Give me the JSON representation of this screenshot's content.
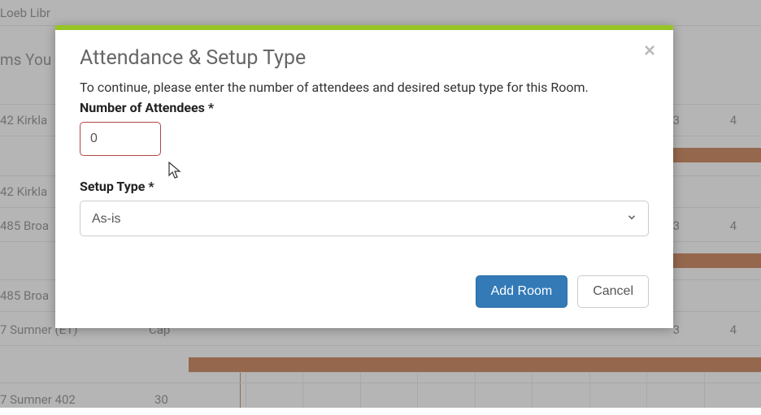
{
  "background": {
    "header_partial": "ms You",
    "rows": [
      {
        "label": "Loeb Libr",
        "cap": ""
      },
      {
        "label": "42 Kirkla",
        "cap": ""
      },
      {
        "label": "42 Kirkla",
        "cap": ""
      },
      {
        "label": "485 Broa",
        "cap": ""
      },
      {
        "label": "485 Broa",
        "cap": ""
      },
      {
        "label": "7 Sumner (ET)",
        "cap": "Cap"
      },
      {
        "label": "7 Sumner 402",
        "cap": "30"
      }
    ],
    "col_numbers": [
      "3",
      "4"
    ]
  },
  "modal": {
    "title": "Attendance & Setup Type",
    "description": "To continue, please enter the number of attendees and desired setup type for this Room.",
    "attendees_label": "Number of Attendees *",
    "attendees_value": "0",
    "setup_label": "Setup Type *",
    "setup_value": "As-is",
    "add_room_label": "Add Room",
    "cancel_label": "Cancel"
  }
}
